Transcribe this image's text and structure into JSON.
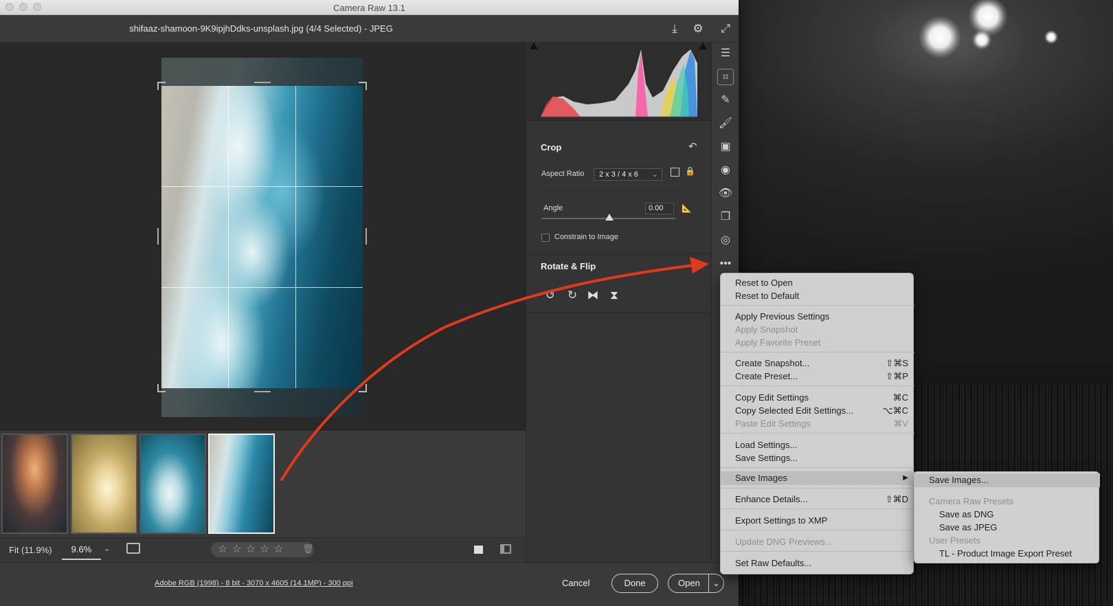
{
  "window": {
    "title": "Camera Raw 13.1",
    "filename": "shifaaz-shamoon-9K9ipjhDdks-unsplash.jpg (4/4 Selected)  -  JPEG"
  },
  "toolbar": {
    "zoom_fit": "Fit (11.9%)",
    "zoom_value": "9.6%",
    "rating_stars": "☆☆☆☆☆"
  },
  "footer": {
    "info": "Adobe RGB (1998) - 8 bit - 3070 x 4605 (14.1MP) - 300 ppi",
    "cancel": "Cancel",
    "done": "Done",
    "open": "Open"
  },
  "crop": {
    "title": "Crop",
    "aspect_label": "Aspect Ratio",
    "aspect_value": "2 x 3 / 4 x 6",
    "angle_label": "Angle",
    "angle_value": "0.00",
    "constrain_label": "Constrain to Image"
  },
  "rotate": {
    "title": "Rotate & Flip"
  },
  "menu": {
    "items": [
      {
        "label": "Reset to Open",
        "shortcut": "",
        "enabled": true
      },
      {
        "label": "Reset to Default",
        "shortcut": "",
        "enabled": true
      },
      {
        "label": "Apply Previous Settings",
        "shortcut": "",
        "enabled": true
      },
      {
        "label": "Apply Snapshot",
        "shortcut": "",
        "enabled": false
      },
      {
        "label": "Apply Favorite Preset",
        "shortcut": "",
        "enabled": false
      },
      {
        "label": "Create Snapshot...",
        "shortcut": "⇧⌘S",
        "enabled": true
      },
      {
        "label": "Create Preset...",
        "shortcut": "⇧⌘P",
        "enabled": true
      },
      {
        "label": "Copy Edit Settings",
        "shortcut": "⌘C",
        "enabled": true
      },
      {
        "label": "Copy Selected Edit Settings...",
        "shortcut": "⌥⌘C",
        "enabled": true
      },
      {
        "label": "Paste Edit Settings",
        "shortcut": "⌘V",
        "enabled": false
      },
      {
        "label": "Load Settings...",
        "shortcut": "",
        "enabled": true
      },
      {
        "label": "Save Settings...",
        "shortcut": "",
        "enabled": true
      },
      {
        "label": "Save Images",
        "shortcut": "▶",
        "enabled": true
      },
      {
        "label": "Enhance Details...",
        "shortcut": "⇧⌘D",
        "enabled": true
      },
      {
        "label": "Export Settings to XMP",
        "shortcut": "",
        "enabled": true
      },
      {
        "label": "Update DNG Previews...",
        "shortcut": "",
        "enabled": false
      },
      {
        "label": "Set Raw Defaults...",
        "shortcut": "",
        "enabled": true
      }
    ]
  },
  "submenu": {
    "items": [
      {
        "label": "Save Images...",
        "enabled": true
      },
      {
        "label": "Camera Raw Presets",
        "enabled": false
      },
      {
        "label": "Save as DNG",
        "enabled": true
      },
      {
        "label": "Save as JPEG",
        "enabled": true
      },
      {
        "label": "User Presets",
        "enabled": false
      },
      {
        "label": "TL - Product Image Export Preset",
        "enabled": true
      }
    ]
  },
  "colors": {
    "annotation_arrow": "#e03a1e",
    "panel_bg": "#343434",
    "menu_bg": "#d6d6d6"
  }
}
